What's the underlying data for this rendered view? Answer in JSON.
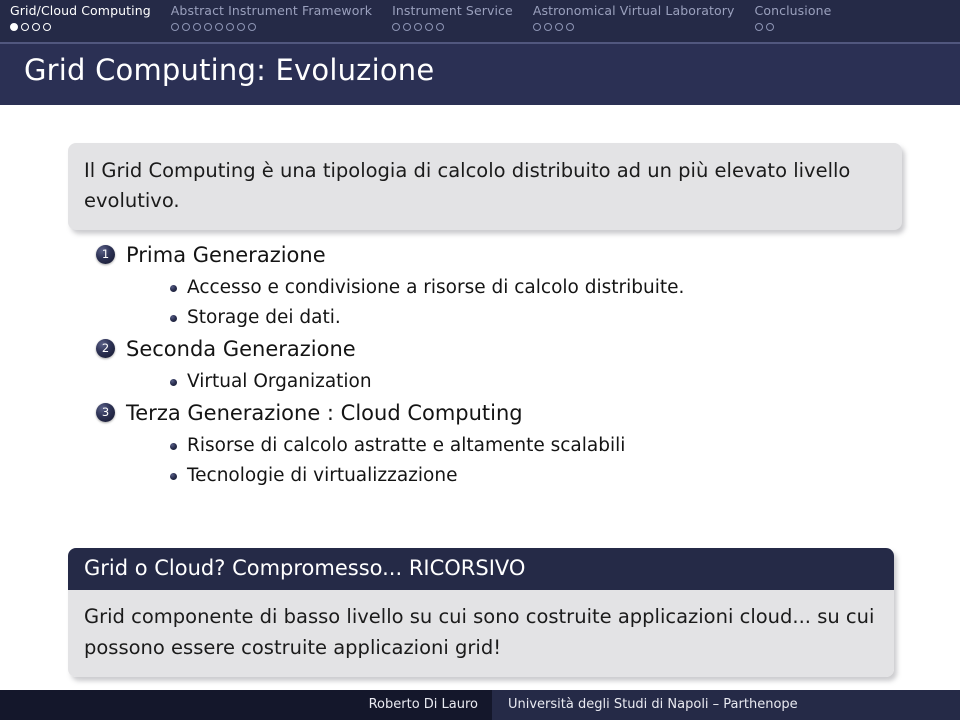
{
  "nav": {
    "sections": [
      {
        "label": "Grid/Cloud Computing",
        "dots": 4,
        "filled_index": 0,
        "current": true
      },
      {
        "label": "Abstract Instrument Framework",
        "dots": 8,
        "filled_index": -1,
        "current": false
      },
      {
        "label": "Instrument Service",
        "dots": 5,
        "filled_index": -1,
        "current": false
      },
      {
        "label": "Astronomical Virtual Laboratory",
        "dots": 4,
        "filled_index": -1,
        "current": false
      },
      {
        "label": "Conclusione",
        "dots": 2,
        "filled_index": -1,
        "current": false
      }
    ]
  },
  "title": "Grid Computing: Evoluzione",
  "intro_block": {
    "text": "Il Grid Computing è una tipologia di calcolo distribuito ad un più elevato livello evolutivo."
  },
  "enumeration": [
    {
      "number": "1",
      "label": "Prima Generazione",
      "subitems": [
        "Accesso e condivisione a risorse di calcolo distribuite.",
        "Storage dei dati."
      ]
    },
    {
      "number": "2",
      "label": "Seconda Generazione",
      "subitems": [
        "Virtual Organization"
      ]
    },
    {
      "number": "3",
      "label": "Terza Generazione : Cloud Computing",
      "subitems": [
        "Risorse di calcolo astratte e altamente scalabili",
        "Tecnologie di virtualizzazione"
      ]
    }
  ],
  "highlight_block": {
    "title": "Grid o Cloud? Compromesso... RICORSIVO",
    "body": "Grid componente di basso livello su cui sono costruite applicazioni cloud... su cui possono essere costruite applicazioni grid!"
  },
  "footer": {
    "author": "Roberto Di Lauro",
    "institution": "Università degli Studi di Napoli – Parthenope"
  },
  "colors": {
    "nav_bar": "#252a47",
    "title_bar": "#2b3054",
    "block_bg": "#e3e3e5",
    "block_title_bg": "#252a47",
    "footer_left": "#14172b",
    "footer_right": "#252a47"
  }
}
